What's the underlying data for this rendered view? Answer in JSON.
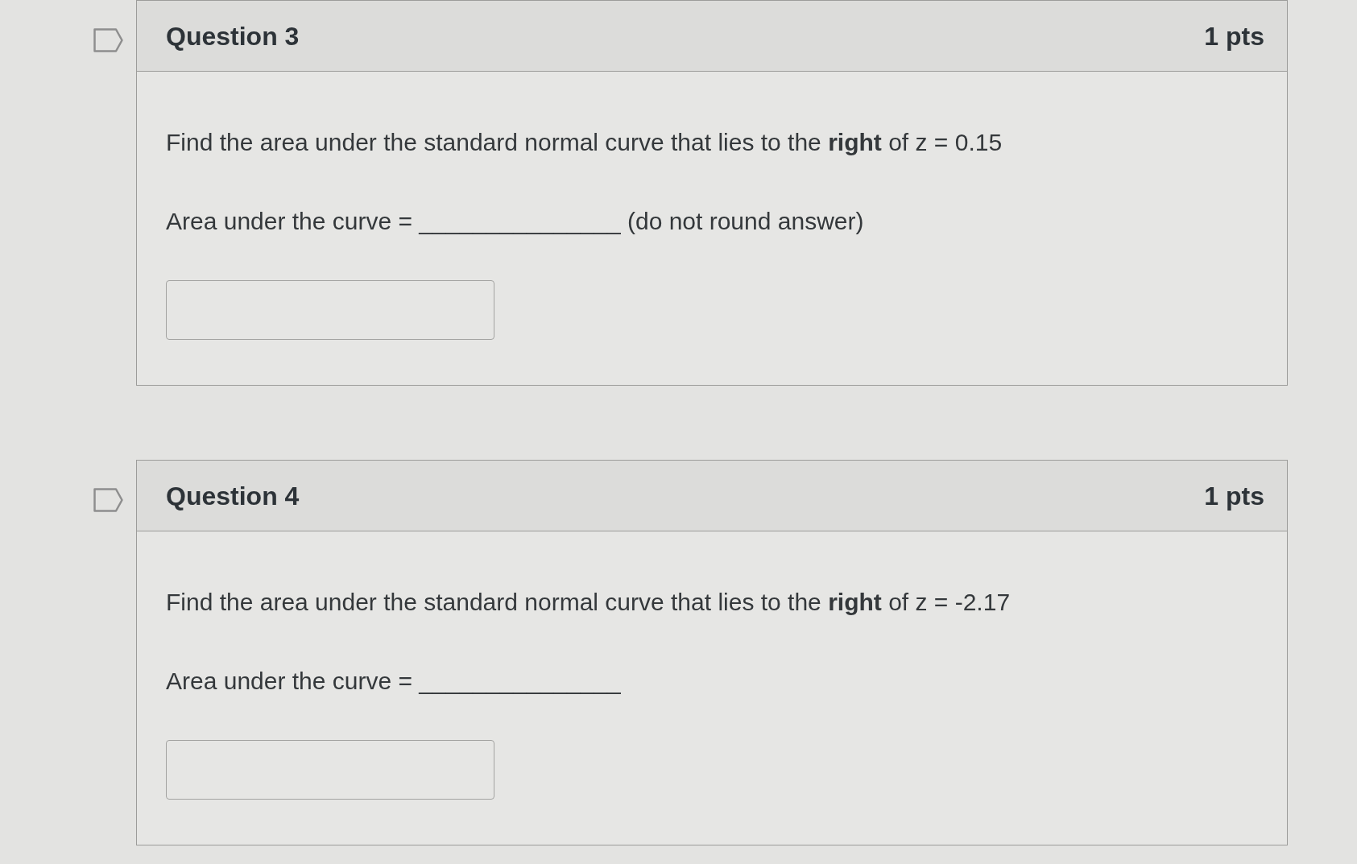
{
  "questions": [
    {
      "title": "Question 3",
      "points": "1 pts",
      "flagged": false,
      "prompt": "Find the area under the standard normal curve that lies to the **right** of z = 0.15",
      "answer_line": "Area under the curve = _______________ (do not round answer)"
    },
    {
      "title": "Question 4",
      "points": "1 pts",
      "flagged": false,
      "prompt": "Find the area under the standard normal curve that lies to the **right** of z = -2.17",
      "answer_line": "Area under the curve = _______________"
    }
  ]
}
